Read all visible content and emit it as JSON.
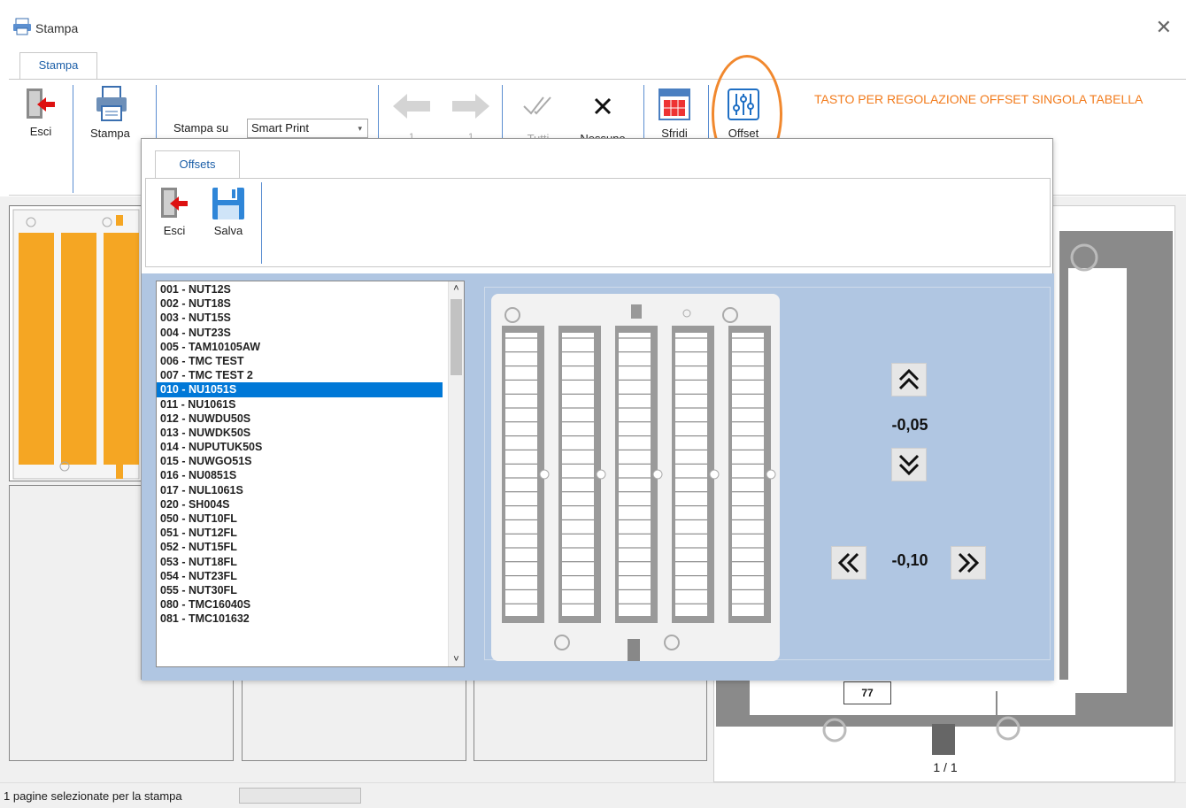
{
  "window": {
    "title": "Stampa",
    "close": "✕"
  },
  "main_tab": "Stampa",
  "toolbar": {
    "esci": "Esci",
    "stampa": "Stampa",
    "stampa_su_label": "Stampa su",
    "printer_value": "Smart Print",
    "prev_page_num": "1",
    "next_page_num": "1",
    "tutti": "Tutti",
    "nessuno": "Nessuno",
    "sfridi": "Sfridi",
    "offset": "Offset"
  },
  "annotation": "TASTO PER REGOLAZIONE OFFSET SINGOLA TABELLA",
  "page_preview": {
    "counter": "1  /  1",
    "label_number": "77"
  },
  "status": {
    "text": "1 pagine selezionate per la stampa"
  },
  "dialog": {
    "tab": "Offsets",
    "esci": "Esci",
    "salva": "Salva",
    "list": [
      "001 - NUT12S",
      "002 - NUT18S",
      "003 - NUT15S",
      "004 - NUT23S",
      "005 - TAM10105AW",
      "006 - TMC TEST",
      "007 - TMC TEST 2",
      "010 - NU1051S",
      "011 - NU1061S",
      "012 - NUWDU50S",
      "013 - NUWDK50S",
      "014 - NUPUTUK50S",
      "015 - NUWGO51S",
      "016 - NU0851S",
      "017 - NUL1061S",
      "020 - SH004S",
      "050 - NUT10FL",
      "051 - NUT12FL",
      "052 - NUT15FL",
      "053 - NUT18FL",
      "054 - NUT23FL",
      "055 - NUT30FL",
      "080 - TMC16040S",
      "081 - TMC101632"
    ],
    "selected_index": 7,
    "offset_vertical": "-0,05",
    "offset_horizontal": "-0,10"
  },
  "colors": {
    "accent": "#0078d7",
    "annotation": "#f27b1c",
    "panel": "#b0c6e2",
    "label_orange": "#f5a623"
  }
}
